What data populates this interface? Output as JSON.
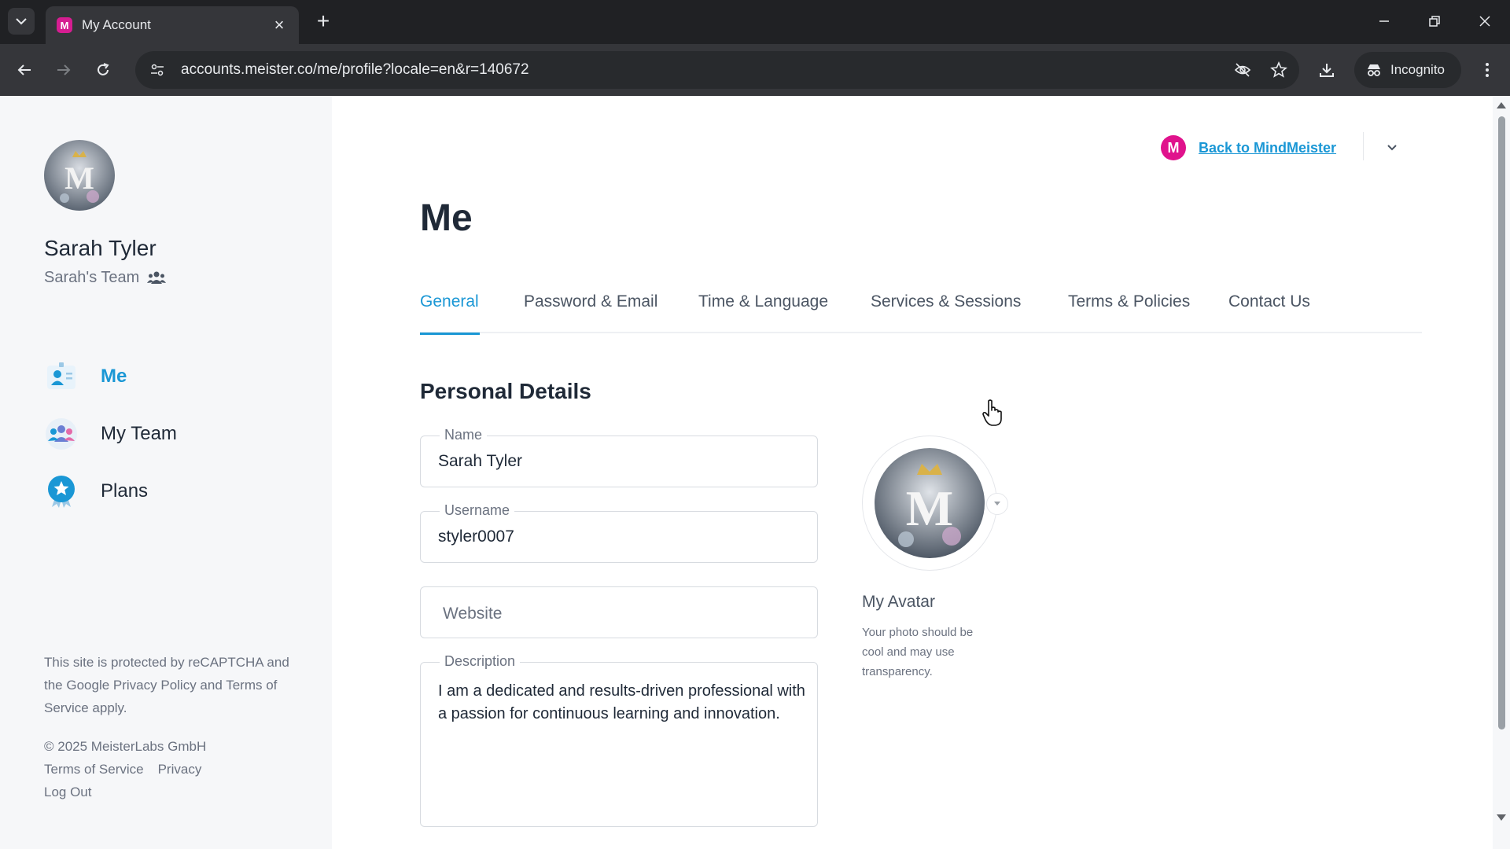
{
  "browser": {
    "tab_title": "My Account",
    "url": "accounts.meister.co/me/profile?locale=en&r=140672",
    "incognito_label": "Incognito"
  },
  "sidebar": {
    "user_name": "Sarah Tyler",
    "team_name": "Sarah's Team",
    "nav": [
      {
        "label": "Me",
        "icon": "user-card-icon"
      },
      {
        "label": "My Team",
        "icon": "team-icon"
      },
      {
        "label": "Plans",
        "icon": "plans-badge-icon"
      }
    ],
    "legal_text": "This site is protected by reCAPTCHA and the Google Privacy Policy and Terms of Service apply.",
    "copyright": "© 2025 MeisterLabs GmbH",
    "footer_links": [
      "Terms of Service",
      "Privacy"
    ],
    "logout": "Log Out"
  },
  "header": {
    "back_link": "Back to MindMeister",
    "logo_letter": "M"
  },
  "main": {
    "title": "Me",
    "tabs": [
      "General",
      "Password & Email",
      "Time & Language",
      "Services & Sessions",
      "Terms & Policies",
      "Contact Us"
    ],
    "active_tab": "General",
    "section_title": "Personal Details",
    "fields": {
      "name": {
        "label": "Name",
        "value": "Sarah Tyler"
      },
      "username": {
        "label": "Username",
        "value": "styler0007"
      },
      "website": {
        "placeholder": "Website",
        "value": ""
      },
      "description": {
        "label": "Description",
        "value": "I am a dedicated and results-driven professional with a passion for continuous learning and innovation."
      }
    },
    "avatar": {
      "title": "My Avatar",
      "hint": "Your photo should be cool and may use transparency."
    }
  },
  "colors": {
    "accent": "#1a97d5",
    "brand": "#e0128c"
  }
}
